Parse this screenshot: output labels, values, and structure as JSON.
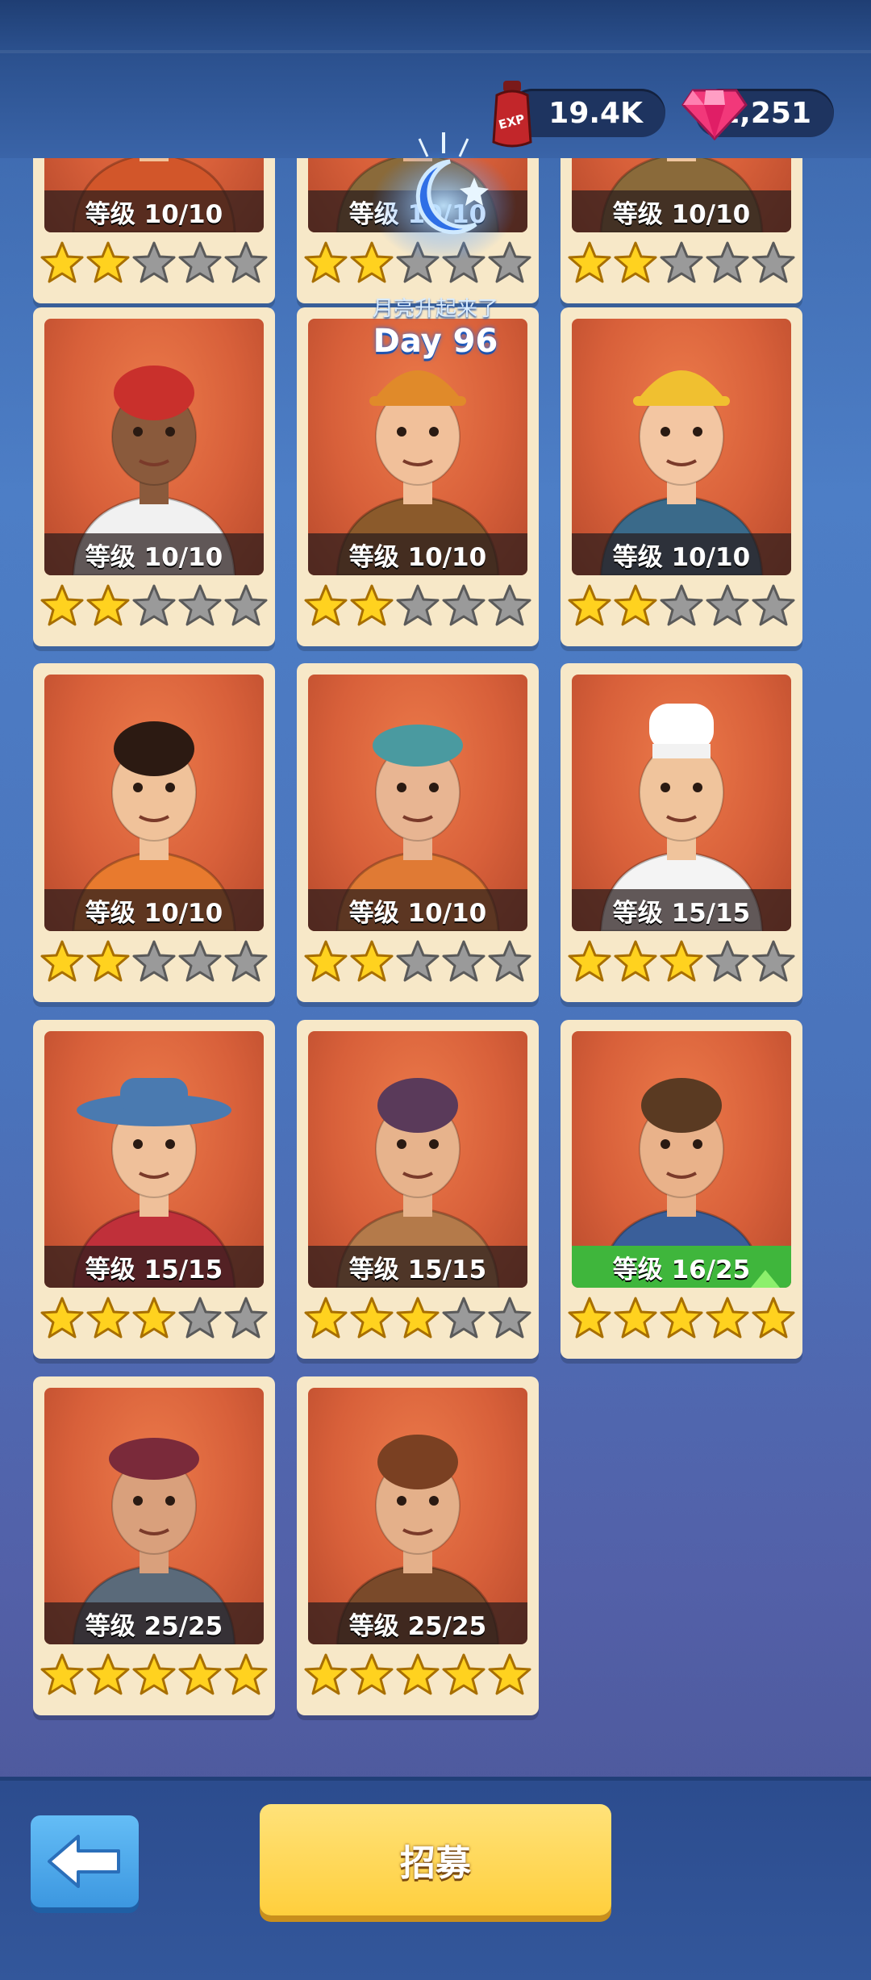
{
  "resources": {
    "exp_icon_label": "EXP",
    "exp_value": "19.4K",
    "gem_value": "1,251"
  },
  "day_banner": {
    "subtitle": "月亮升起来了",
    "day": "Day 96"
  },
  "workers": [
    {
      "level": "等级 10/10",
      "stars": 2,
      "figure": "firefighter",
      "partial": true
    },
    {
      "level": "等级 10/10",
      "stars": 2,
      "figure": "worker",
      "partial": true
    },
    {
      "level": "等级 10/10",
      "stars": 2,
      "figure": "worker",
      "partial": true
    },
    {
      "level": "等级 10/10",
      "stars": 2,
      "figure": "scientist"
    },
    {
      "level": "等级 10/10",
      "stars": 2,
      "figure": "builder"
    },
    {
      "level": "等级 10/10",
      "stars": 2,
      "figure": "hard-hat-worker"
    },
    {
      "level": "等级 10/10",
      "stars": 2,
      "figure": "mechanic"
    },
    {
      "level": "等级 10/10",
      "stars": 2,
      "figure": "smith"
    },
    {
      "level": "等级 15/15",
      "stars": 3,
      "figure": "chef"
    },
    {
      "level": "等级 15/15",
      "stars": 3,
      "figure": "farmer"
    },
    {
      "level": "等级 15/15",
      "stars": 3,
      "figure": "brewer"
    },
    {
      "level": "等级 16/25",
      "stars": 5,
      "figure": "engineer",
      "upgradable": true
    },
    {
      "level": "等级 25/25",
      "stars": 5,
      "figure": "soldier"
    },
    {
      "level": "等级 25/25",
      "stars": 5,
      "figure": "pilot"
    }
  ],
  "bottom": {
    "recruit_label": "招募",
    "back_icon": "back-arrow-icon"
  },
  "colors": {
    "star_filled": "#ffd21f",
    "star_empty": "#9a9a9a",
    "level_bar_upgradable": "#3fb63c",
    "recruit_button": "#ffcf3d",
    "back_button": "#4aa6ea"
  }
}
